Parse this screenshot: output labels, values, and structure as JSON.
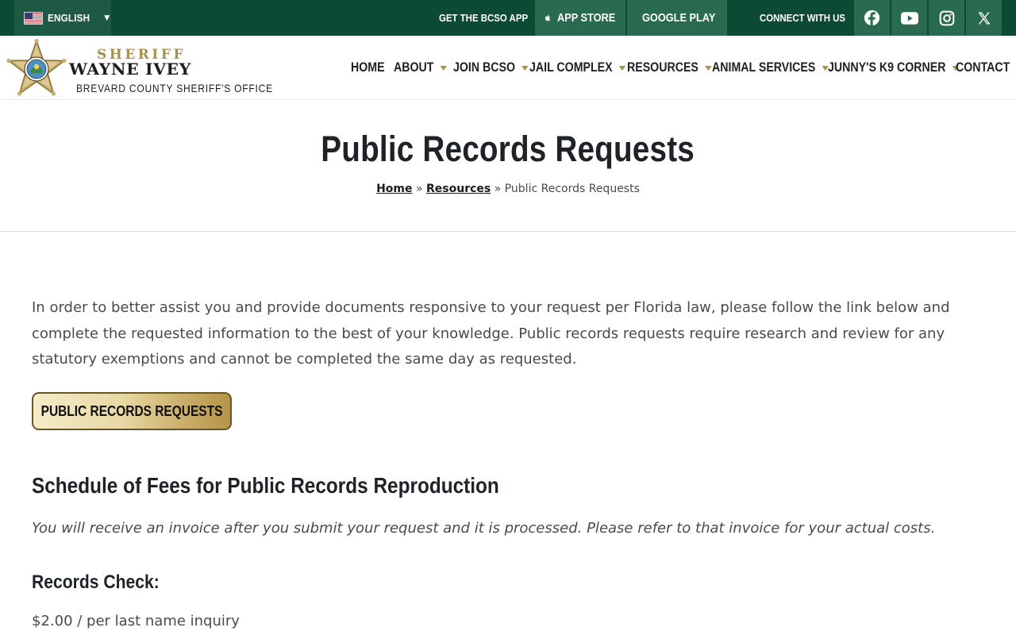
{
  "topbar": {
    "language": {
      "label": "ENGLISH",
      "icon": "us-flag-icon"
    },
    "get_app_label": "GET THE BCSO APP",
    "app_store_label": "APP STORE",
    "google_play_label": "GOOGLE PLAY",
    "connect_label": "CONNECT WITH US",
    "social": [
      "facebook-icon",
      "youtube-icon",
      "instagram-icon",
      "x-icon"
    ]
  },
  "logo": {
    "line1": "SHERIFF",
    "line2": "WAYNE IVEY",
    "line3": "BREVARD COUNTY SHERIFF'S OFFICE"
  },
  "nav": [
    {
      "label": "HOME",
      "dropdown": false
    },
    {
      "label": "ABOUT",
      "dropdown": true
    },
    {
      "label": "JOIN BCSO",
      "dropdown": true
    },
    {
      "label": "JAIL COMPLEX",
      "dropdown": true
    },
    {
      "label": "RESOURCES",
      "dropdown": true
    },
    {
      "label": "ANIMAL SERVICES",
      "dropdown": true
    },
    {
      "label": "JUNNY'S K9 CORNER",
      "dropdown": true
    },
    {
      "label": "CONTACT",
      "dropdown": false
    }
  ],
  "page": {
    "title": "Public Records Requests",
    "breadcrumb": {
      "home": "Home",
      "sep": "»",
      "resources": "Resources",
      "current": "Public Records Requests"
    }
  },
  "content": {
    "intro": "In order to better assist you and provide documents responsive to your request per Florida law, please follow the link below and complete the requested information to the best of your knowledge. Public records requests require research and review for any statutory exemptions and cannot be completed the same day as requested.",
    "cta_label": "PUBLIC RECORDS REQUESTS",
    "fees_heading": "Schedule of Fees for Public Records Reproduction",
    "fees_note": "You will receive an invoice after you submit your request and it is processed. Please refer to that invoice for your actual costs.",
    "records_check_heading": "Records Check:",
    "records_check_price": "$2.00 / per last name inquiry"
  },
  "colors": {
    "topbar_bg": "#0c4a33",
    "topbar_btn_bg": "#2a6b50",
    "gold": "#a8914a",
    "heading": "#1f2328",
    "body_text": "#4a4a4a"
  }
}
